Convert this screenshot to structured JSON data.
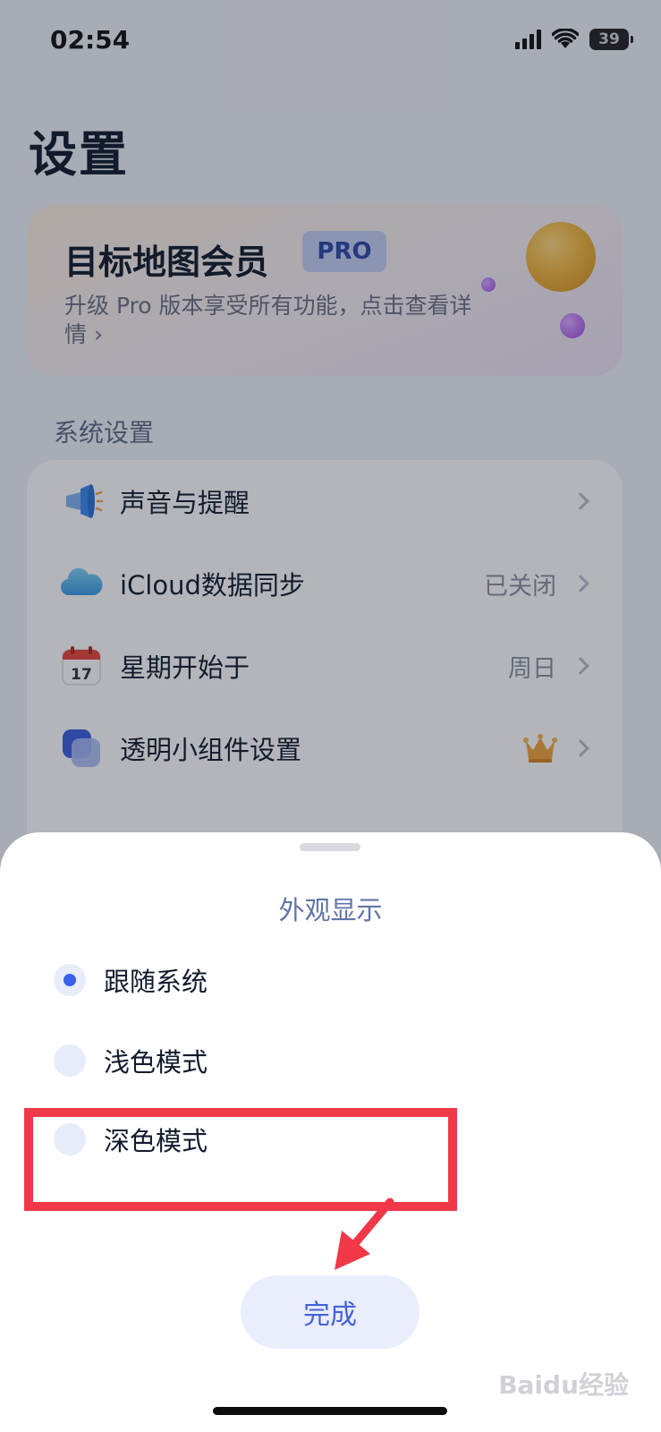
{
  "status_bar": {
    "time": "02:54",
    "battery": "39"
  },
  "page": {
    "title": "设置",
    "pro_card": {
      "title": "目标地图会员",
      "badge": "PRO",
      "description": "升级 Pro 版本享受所有功能，点击查看详情 ›"
    },
    "section_title": "系统设置",
    "rows": [
      {
        "label": "声音与提醒",
        "value": "",
        "icon": "megaphone-icon"
      },
      {
        "label": "iCloud数据同步",
        "value": "已关闭",
        "icon": "cloud-icon"
      },
      {
        "label": "星期开始于",
        "value": "周日",
        "icon": "calendar-icon"
      },
      {
        "label": "透明小组件设置",
        "value": "",
        "icon": "widget-icon"
      }
    ],
    "calendar_day": "17"
  },
  "sheet": {
    "title": "外观显示",
    "options": [
      {
        "label": "跟随系统",
        "selected": true
      },
      {
        "label": "浅色模式",
        "selected": false
      },
      {
        "label": "深色模式",
        "selected": false
      }
    ],
    "done_label": "完成"
  },
  "colors": {
    "accent": "#3b5fe6",
    "highlight": "#f03849"
  },
  "watermark": "Baidu经验"
}
